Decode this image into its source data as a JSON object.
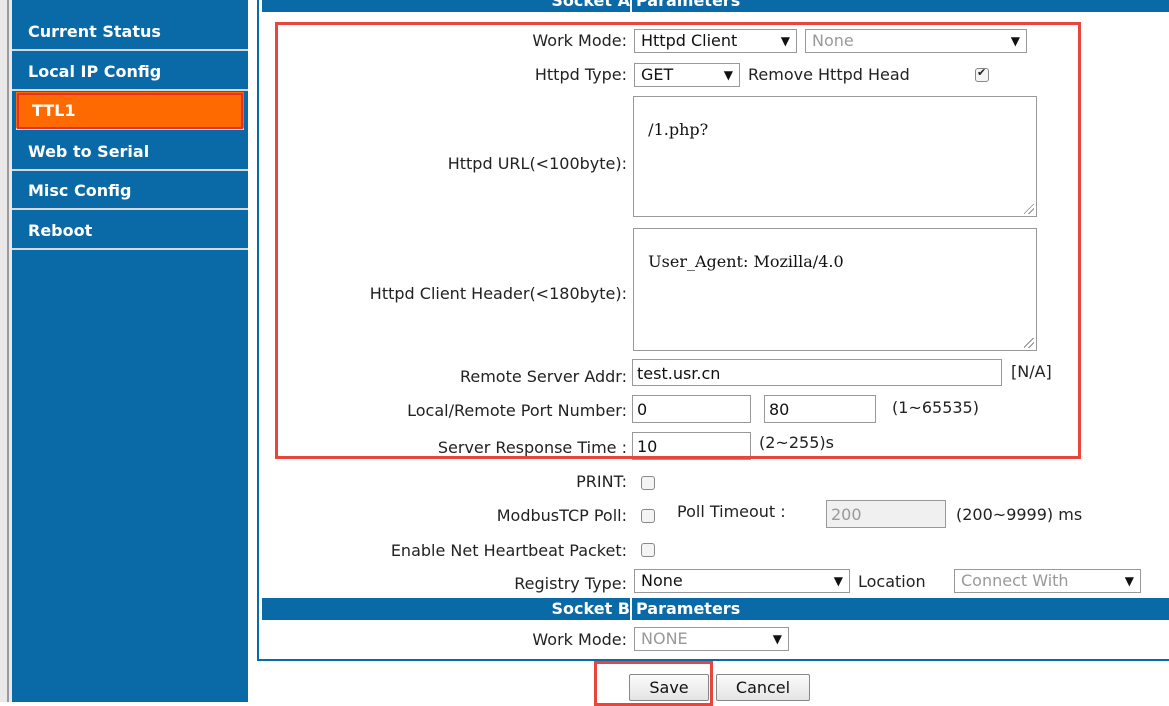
{
  "sidebar": {
    "items": [
      {
        "label": "Current Status"
      },
      {
        "label": "Local IP Config"
      },
      {
        "label": "TTL1"
      },
      {
        "label": "Web to Serial"
      },
      {
        "label": "Misc Config"
      },
      {
        "label": "Reboot"
      }
    ]
  },
  "socket_a": {
    "header_left": "Socket A",
    "header_right": "Parameters",
    "work_mode_label": "Work Mode:",
    "work_mode_value": "Httpd Client",
    "work_mode_secondary": "None",
    "httpd_type_label": "Httpd Type:",
    "httpd_type_value": "GET",
    "remove_head_label": "Remove Httpd Head",
    "httpd_url_label": "Httpd URL(<100byte):",
    "httpd_url_value": "/1.php?",
    "client_header_label": "Httpd Client Header(<180byte):",
    "client_header_value": "User_Agent: Mozilla/4.0",
    "remote_addr_label": "Remote Server Addr:",
    "remote_addr_value": "test.usr.cn",
    "remote_addr_hint": "[N/A]",
    "port_label": "Local/Remote Port Number:",
    "local_port": "0",
    "remote_port": "80",
    "port_hint": "(1~65535)",
    "response_label": "Server Response Time :",
    "response_value": "10",
    "response_hint": "(2~255)s",
    "print_label": "PRINT:",
    "modbus_label": "ModbusTCP Poll:",
    "poll_timeout_label": "Poll Timeout :",
    "poll_timeout_value": "200",
    "poll_timeout_hint": "(200~9999) ms",
    "heartbeat_label": "Enable Net Heartbeat Packet:",
    "registry_label": "Registry Type:",
    "registry_value": "None",
    "location_label": "Location",
    "location_value": "Connect With"
  },
  "socket_b": {
    "header_left": "Socket B",
    "header_right": "Parameters",
    "work_mode_label": "Work Mode:",
    "work_mode_value": "NONE"
  },
  "buttons": {
    "save": "Save",
    "cancel": "Cancel"
  },
  "colors": {
    "sidebar": "#0a6aa8",
    "active": "#ff6a00",
    "highlight": "#e8453c"
  }
}
